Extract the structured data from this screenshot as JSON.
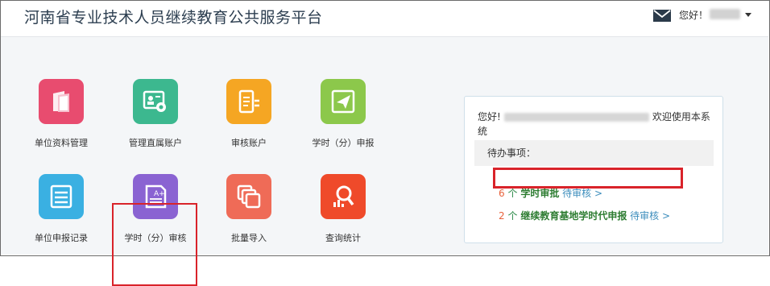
{
  "header": {
    "title": "河南省专业技术人员继续教育公共服务平台",
    "greeting": "您好！",
    "icons": {
      "mail": "mail-icon",
      "dropdown": "caret-down-icon"
    }
  },
  "tiles": [
    {
      "label": "单位资料管理",
      "icon": "unit-info-icon",
      "color": "#e84c6f"
    },
    {
      "label": "管理直属账户",
      "icon": "account-settings-icon",
      "color": "#3cb88f"
    },
    {
      "label": "审核账户",
      "icon": "review-account-icon",
      "color": "#f5a623"
    },
    {
      "label": "学时（分）申报",
      "icon": "paper-plane-icon",
      "color": "#8cc84b"
    },
    {
      "label": "单位申报记录",
      "icon": "list-record-icon",
      "color": "#3ab0e2"
    },
    {
      "label": "学时（分）审核",
      "icon": "grade-review-icon",
      "color": "#8a63d2"
    },
    {
      "label": "批量导入",
      "icon": "batch-import-icon",
      "color": "#ef6b57"
    },
    {
      "label": "查询统计",
      "icon": "search-stats-icon",
      "color": "#ef4a2a"
    }
  ],
  "panel": {
    "welcome_prefix": "您好!",
    "welcome_suffix": "欢迎使用本系统",
    "todo_label": "待办事项：",
    "tasks": [
      {
        "count": "6",
        "unit": "个",
        "name": "学时审批",
        "action": "待审核 >"
      },
      {
        "count": "2",
        "unit": "个",
        "name": "继续教育基地学时代申报",
        "action": "待审核 >"
      }
    ]
  },
  "colors": {
    "highlight": "#d9232a",
    "title": "#2c3e50"
  }
}
